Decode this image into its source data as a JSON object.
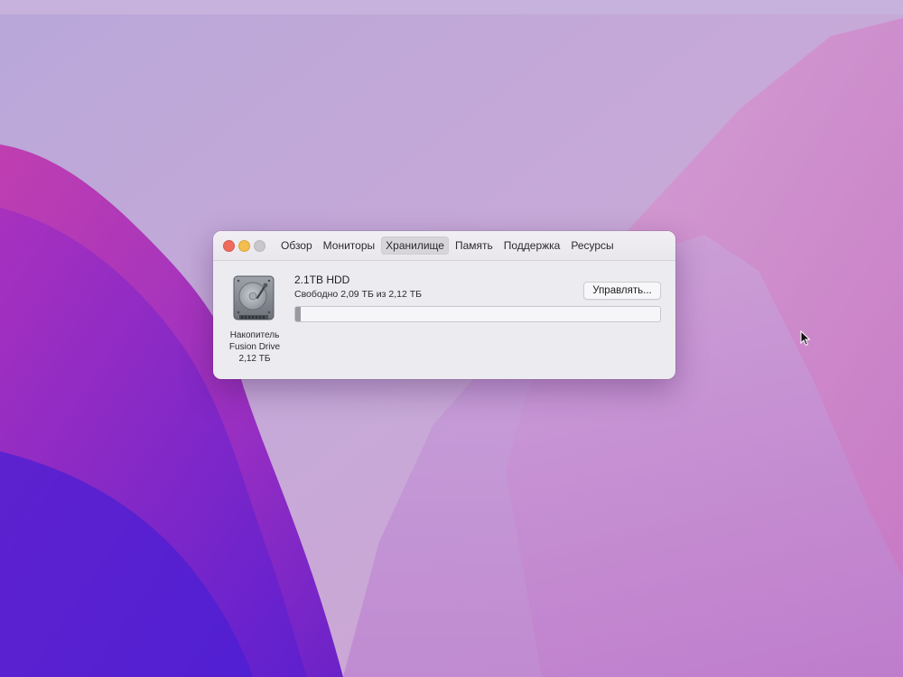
{
  "window": {
    "tabs": [
      {
        "label": "Обзор",
        "active": false
      },
      {
        "label": "Мониторы",
        "active": false
      },
      {
        "label": "Хранилище",
        "active": true
      },
      {
        "label": "Память",
        "active": false
      },
      {
        "label": "Поддержка",
        "active": false
      },
      {
        "label": "Ресурсы",
        "active": false
      }
    ]
  },
  "storage": {
    "drive_icon": "hard-drive-icon",
    "drive_label_line1": "Накопитель",
    "drive_label_line2": "Fusion Drive",
    "drive_label_line3": "2,12 ТБ",
    "drive_name": "2.1TB HDD",
    "free_text": "Свободно 2,09 ТБ из 2,12 ТБ",
    "manage_label": "Управлять...",
    "used_fraction": 0.014
  },
  "colors": {
    "close": "#ee6a5e",
    "minimize": "#f4be4f",
    "zoom": "#c9c7cc"
  }
}
